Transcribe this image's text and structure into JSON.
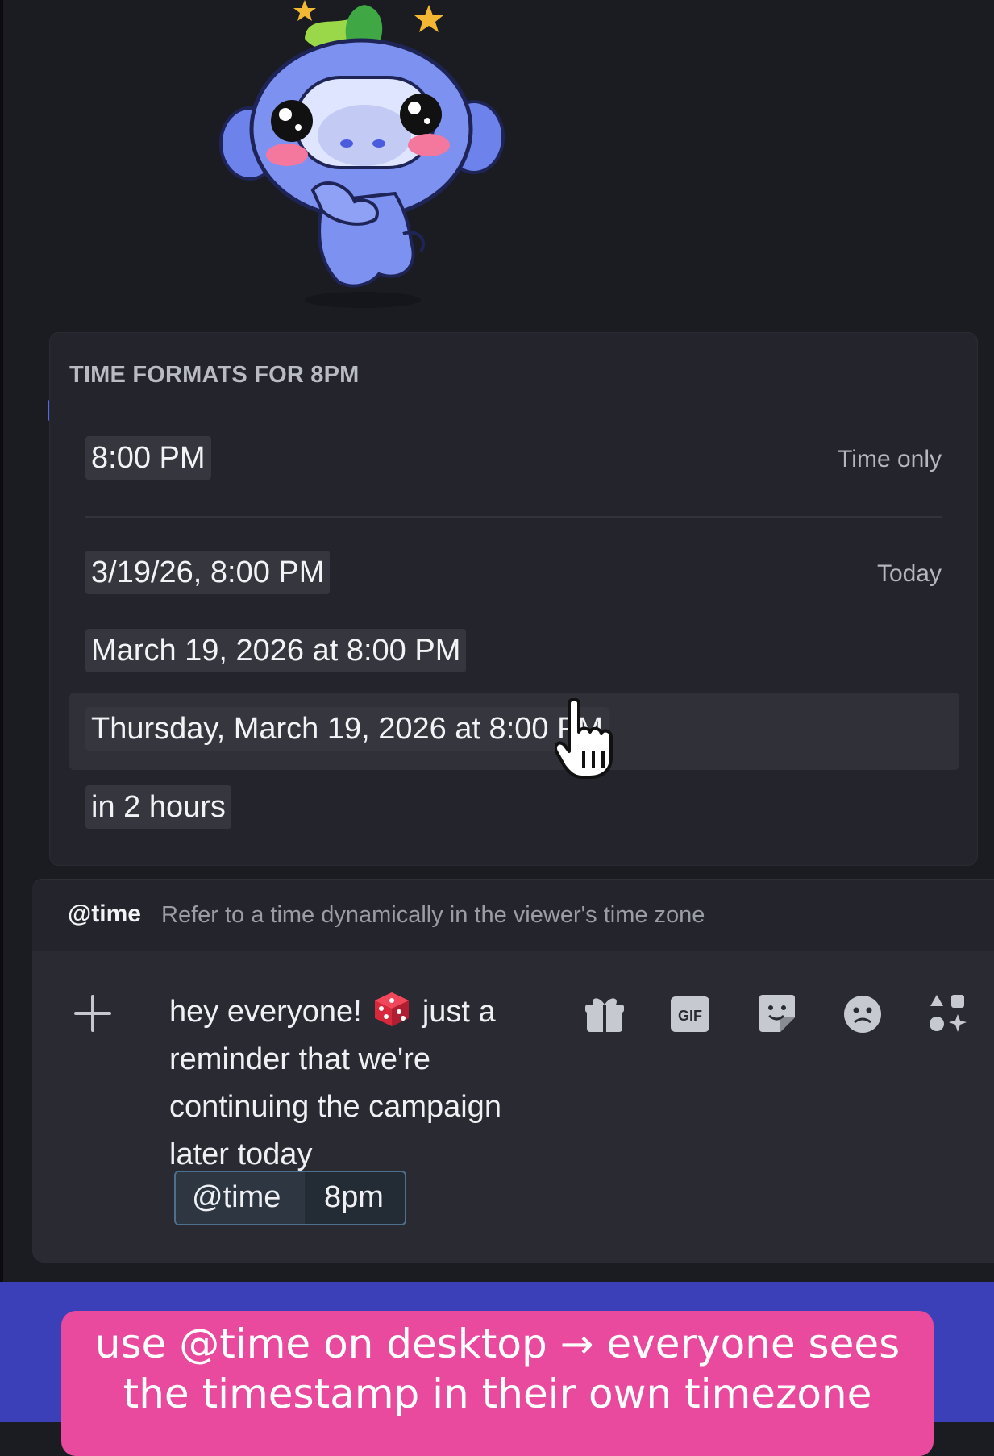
{
  "sticker": {
    "name": "wumpus-sticker"
  },
  "time_formats": {
    "title": "TIME FORMATS FOR 8PM",
    "options": [
      {
        "value": "8:00 PM",
        "label": "Time only"
      },
      {
        "value": "3/19/26, 8:00 PM",
        "label": "Today"
      },
      {
        "value": "March 19, 2026 at 8:00 PM",
        "label": ""
      },
      {
        "value": "Thursday, March 19, 2026 at 8:00 PM",
        "label": ""
      },
      {
        "value": "in 2 hours",
        "label": ""
      }
    ],
    "hovered_index": 3
  },
  "autocomplete": {
    "trigger": "@time",
    "description": "Refer to a time dynamically in the viewer's time zone"
  },
  "composer": {
    "message_before_emoji": "hey everyone!",
    "emoji": "game-die-emoji",
    "message_after_emoji": "just a reminder that we're continuing the campaign later today",
    "mention_command": "@time",
    "mention_argument": "8pm",
    "toolbar_icons": [
      "gift-icon",
      "gif-icon",
      "sticker-icon",
      "emoji-icon",
      "apps-icon"
    ]
  },
  "caption": {
    "line1": "use @time on desktop → everyone sees",
    "line2": "the timestamp in their own timezone"
  },
  "colors": {
    "background": "#1b1c22",
    "panel": "#24252c",
    "chip": "#35363e",
    "banner": "#3b3fb8",
    "caption_bg": "#e94a9d",
    "blurple": "#5865f2"
  }
}
